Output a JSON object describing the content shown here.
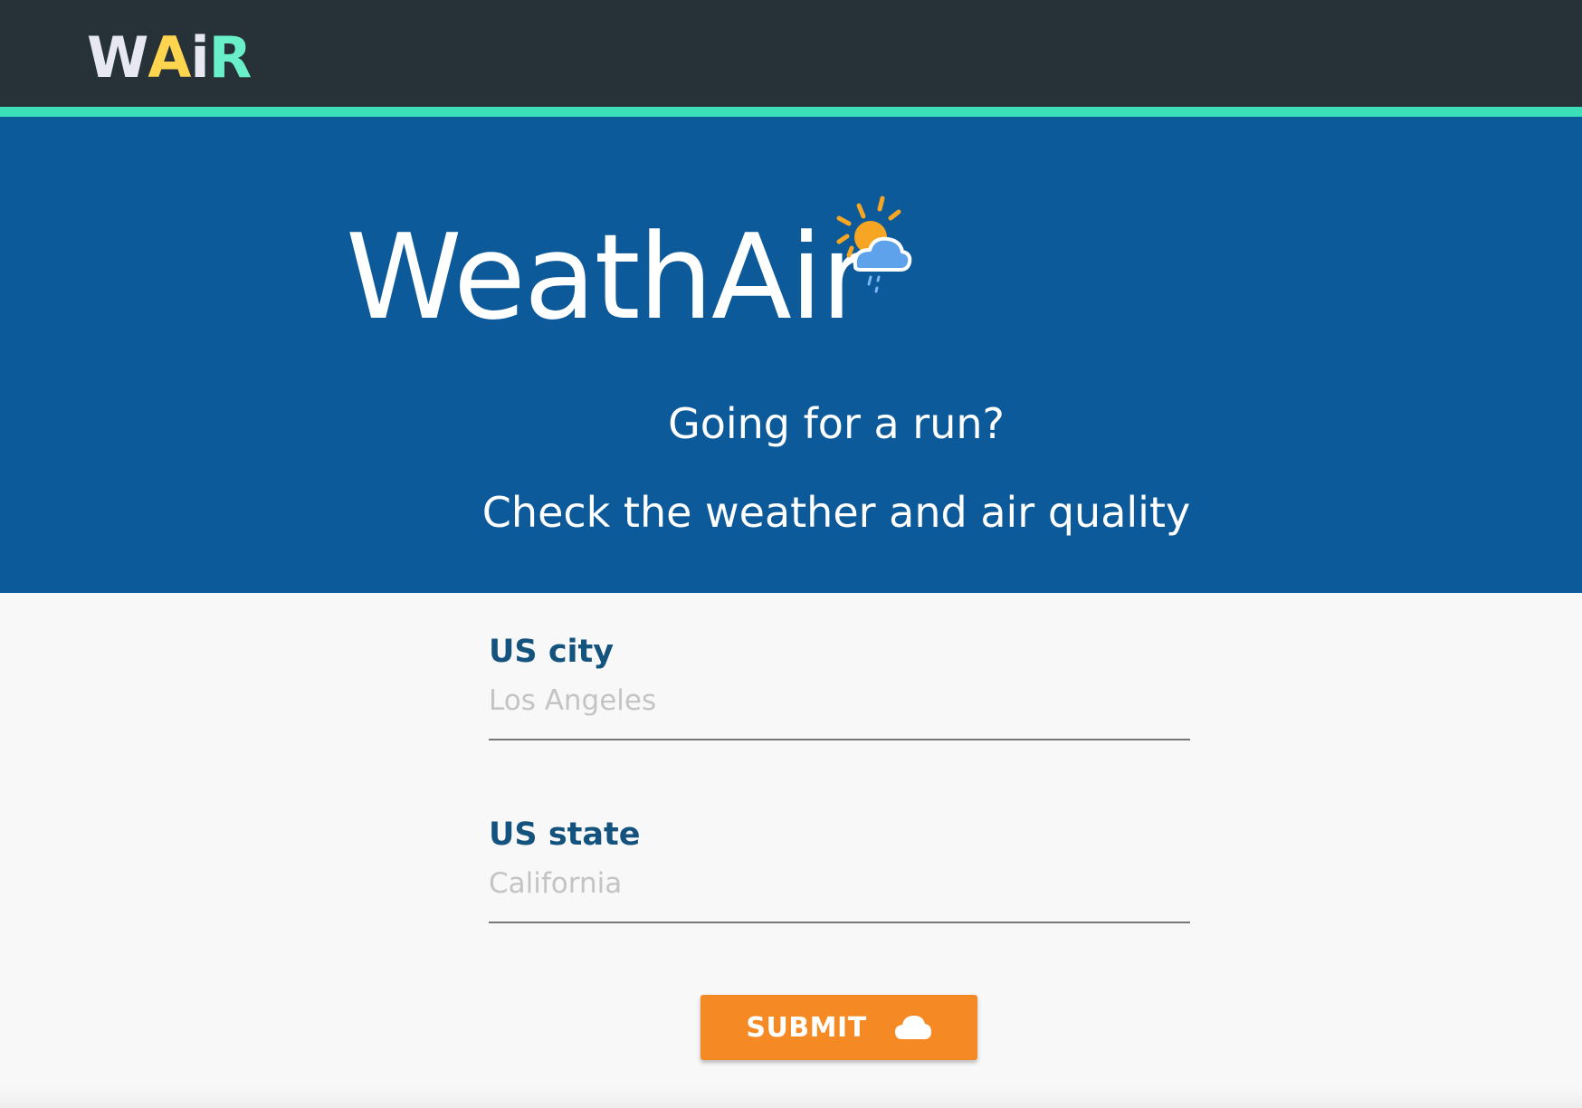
{
  "nav": {
    "logo_letters": [
      {
        "char": "W",
        "color": "#e8e8f2"
      },
      {
        "char": "A",
        "color": "#ffd54f"
      },
      {
        "char": "i",
        "color": "#e8e8f2"
      },
      {
        "char": "R",
        "color": "#69f0c8"
      }
    ],
    "accent_color": "#3be0b8"
  },
  "hero": {
    "title": "WeathAir",
    "icon": "sun-cloud-rain-icon",
    "tagline_1": "Going for a run?",
    "tagline_2": "Check the weather and air quality",
    "background": "#0d5a9b"
  },
  "form": {
    "city_label": "US city",
    "city_placeholder": "Los Angeles",
    "city_value": "",
    "state_label": "US state",
    "state_placeholder": "California",
    "state_value": "",
    "submit_label": "SUBMIT",
    "submit_icon": "cloud-icon",
    "submit_color": "#f58a24"
  }
}
